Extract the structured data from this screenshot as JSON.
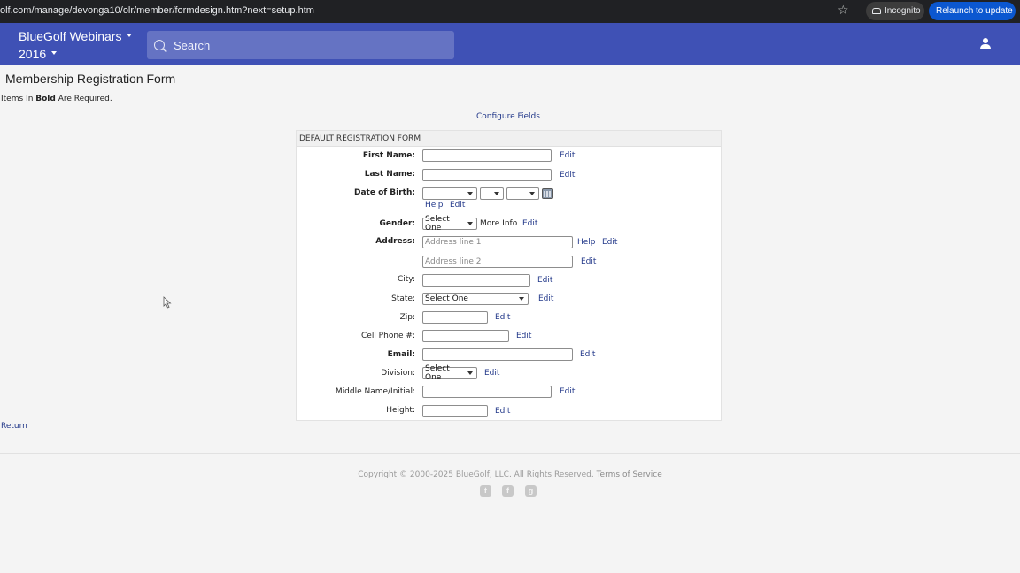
{
  "browser": {
    "url": "olf.com/manage/devonga10/olr/member/formdesign.htm?next=setup.htm",
    "incognito_label": "Incognito",
    "relaunch_label": "Relaunch to update"
  },
  "header": {
    "brand_line1": "BlueGolf Webinars",
    "brand_line2": "2016",
    "search_placeholder": "Search"
  },
  "page": {
    "title": "Membership Registration Form",
    "required_prefix": "Items In ",
    "required_bold": "Bold",
    "required_suffix": " Are Required.",
    "configure_link": "Configure Fields",
    "form_header": "DEFAULT REGISTRATION FORM",
    "return_link": "Return"
  },
  "form": {
    "edit_label": "Edit",
    "help_label": "Help",
    "more_info_label": "More Info",
    "select_one": "Select One",
    "fields": {
      "first_name": "First Name:",
      "last_name": "Last Name:",
      "dob": "Date of Birth:",
      "gender": "Gender:",
      "address": "Address:",
      "address1_placeholder": "Address line 1",
      "address2_placeholder": "Address line 2",
      "city": "City:",
      "state": "State:",
      "zip": "Zip:",
      "cell_phone": "Cell Phone #:",
      "email": "Email:",
      "division": "Division:",
      "middle_name": "Middle Name/Initial:",
      "height": "Height:"
    }
  },
  "footer": {
    "copyright": "Copyright © 2000-2025 BlueGolf, LLC. All Rights Reserved.",
    "terms": "Terms of Service"
  },
  "icons": {
    "twitter": "twitter-icon",
    "facebook": "facebook-icon",
    "google_plus": "google-plus-icon"
  },
  "colors": {
    "appbar": "#3f51b5",
    "link": "#23398a",
    "relaunch": "#0b57d0"
  }
}
